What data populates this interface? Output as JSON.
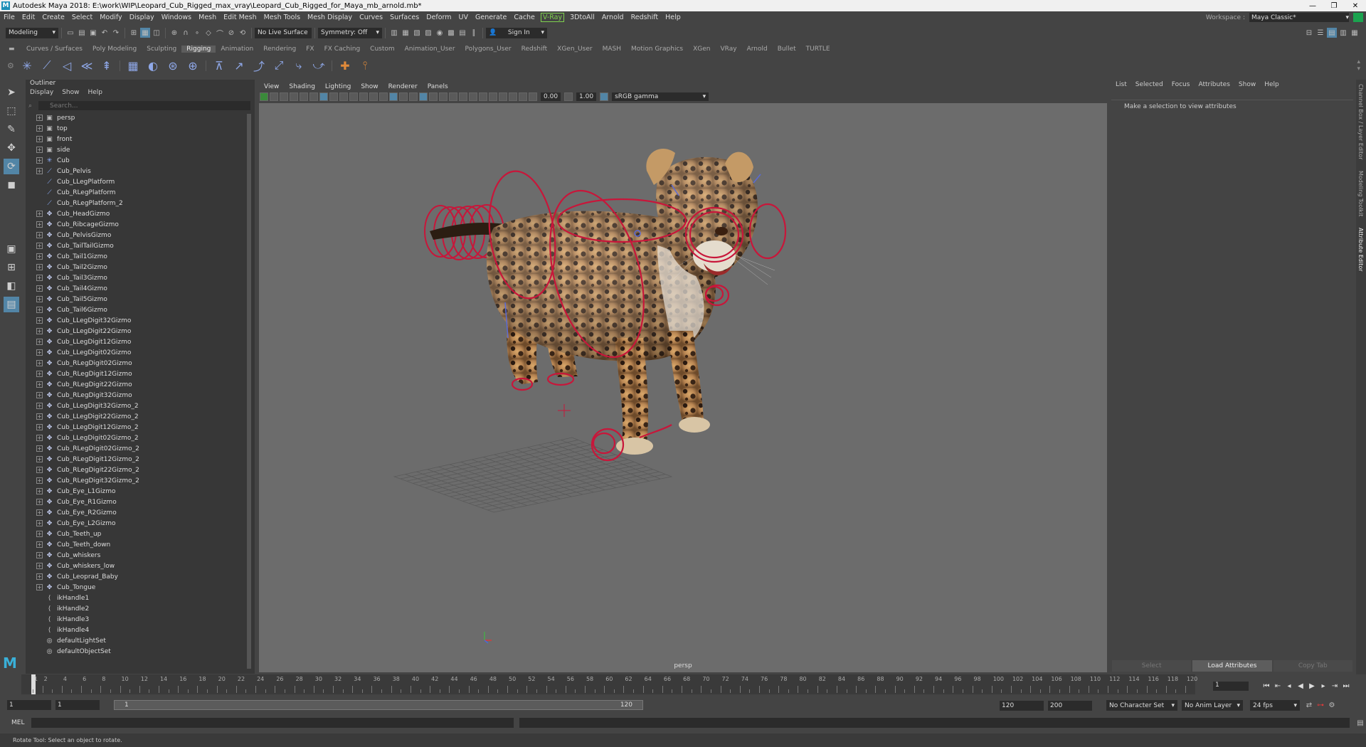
{
  "window": {
    "title": "Autodesk Maya 2018: E:\\work\\WIP\\Leopard_Cub_Rigged_max_vray\\Leopard_Cub_Rigged_for_Maya_mb_arnold.mb*",
    "logo": "M"
  },
  "menubar": {
    "items": [
      "File",
      "Edit",
      "Create",
      "Select",
      "Modify",
      "Display",
      "Windows",
      "Mesh",
      "Edit Mesh",
      "Mesh Tools",
      "Mesh Display",
      "Curves",
      "Surfaces",
      "Deform",
      "UV",
      "Generate",
      "Cache",
      "V-Ray",
      "3DtoAll",
      "Arnold",
      "Redshift",
      "Help"
    ],
    "workspace_label": "Workspace :",
    "workspace_value": "Maya Classic*"
  },
  "statusline": {
    "mode": "Modeling",
    "live_surface": "No Live Surface",
    "symmetry": "Symmetry: Off",
    "sign_in": "Sign In"
  },
  "shelf": {
    "tabs": [
      "Curves / Surfaces",
      "Poly Modeling",
      "Sculpting",
      "Rigging",
      "Animation",
      "Rendering",
      "FX",
      "FX Caching",
      "Custom",
      "Animation_User",
      "Polygons_User",
      "Redshift",
      "XGen_User",
      "MASH",
      "Motion Graphics",
      "XGen",
      "VRay",
      "Arnold",
      "Bullet",
      "TURTLE"
    ],
    "active_tab": "Rigging"
  },
  "outliner": {
    "title": "Outliner",
    "menu": [
      "Display",
      "Show",
      "Help"
    ],
    "search_placeholder": "Search...",
    "items": [
      {
        "name": "persp",
        "icon": "camera-icon",
        "expand": true
      },
      {
        "name": "top",
        "icon": "camera-icon",
        "expand": true
      },
      {
        "name": "front",
        "icon": "camera-icon",
        "expand": true
      },
      {
        "name": "side",
        "icon": "camera-icon",
        "expand": true
      },
      {
        "name": "Cub",
        "icon": "locator-icon",
        "expand": true
      },
      {
        "name": "Cub_Pelvis",
        "icon": "joint-icon",
        "expand": true
      },
      {
        "name": "Cub_LLegPlatform",
        "icon": "joint-icon",
        "expand": false
      },
      {
        "name": "Cub_RLegPlatform",
        "icon": "joint-icon",
        "expand": false
      },
      {
        "name": "Cub_RLegPlatform_2",
        "icon": "joint-icon",
        "expand": false
      },
      {
        "name": "Cub_HeadGizmo",
        "icon": "curve-icon",
        "expand": true
      },
      {
        "name": "Cub_RibcageGizmo",
        "icon": "curve-icon",
        "expand": true
      },
      {
        "name": "Cub_PelvisGizmo",
        "icon": "curve-icon",
        "expand": true
      },
      {
        "name": "Cub_TailTailGizmo",
        "icon": "curve-icon",
        "expand": true
      },
      {
        "name": "Cub_Tail1Gizmo",
        "icon": "curve-icon",
        "expand": true
      },
      {
        "name": "Cub_Tail2Gizmo",
        "icon": "curve-icon",
        "expand": true
      },
      {
        "name": "Cub_Tail3Gizmo",
        "icon": "curve-icon",
        "expand": true
      },
      {
        "name": "Cub_Tail4Gizmo",
        "icon": "curve-icon",
        "expand": true
      },
      {
        "name": "Cub_Tail5Gizmo",
        "icon": "curve-icon",
        "expand": true
      },
      {
        "name": "Cub_Tail6Gizmo",
        "icon": "curve-icon",
        "expand": true
      },
      {
        "name": "Cub_LLegDigit32Gizmo",
        "icon": "curve-icon",
        "expand": true
      },
      {
        "name": "Cub_LLegDigit22Gizmo",
        "icon": "curve-icon",
        "expand": true
      },
      {
        "name": "Cub_LLegDigit12Gizmo",
        "icon": "curve-icon",
        "expand": true
      },
      {
        "name": "Cub_LLegDigit02Gizmo",
        "icon": "curve-icon",
        "expand": true
      },
      {
        "name": "Cub_RLegDigit02Gizmo",
        "icon": "curve-icon",
        "expand": true
      },
      {
        "name": "Cub_RLegDigit12Gizmo",
        "icon": "curve-icon",
        "expand": true
      },
      {
        "name": "Cub_RLegDigit22Gizmo",
        "icon": "curve-icon",
        "expand": true
      },
      {
        "name": "Cub_RLegDigit32Gizmo",
        "icon": "curve-icon",
        "expand": true
      },
      {
        "name": "Cub_LLegDigit32Gizmo_2",
        "icon": "curve-icon",
        "expand": true
      },
      {
        "name": "Cub_LLegDigit22Gizmo_2",
        "icon": "curve-icon",
        "expand": true
      },
      {
        "name": "Cub_LLegDigit12Gizmo_2",
        "icon": "curve-icon",
        "expand": true
      },
      {
        "name": "Cub_LLegDigit02Gizmo_2",
        "icon": "curve-icon",
        "expand": true
      },
      {
        "name": "Cub_RLegDigit02Gizmo_2",
        "icon": "curve-icon",
        "expand": true
      },
      {
        "name": "Cub_RLegDigit12Gizmo_2",
        "icon": "curve-icon",
        "expand": true
      },
      {
        "name": "Cub_RLegDigit22Gizmo_2",
        "icon": "curve-icon",
        "expand": true
      },
      {
        "name": "Cub_RLegDigit32Gizmo_2",
        "icon": "curve-icon",
        "expand": true
      },
      {
        "name": "Cub_Eye_L1Gizmo",
        "icon": "curve-icon",
        "expand": true
      },
      {
        "name": "Cub_Eye_R1Gizmo",
        "icon": "curve-icon",
        "expand": true
      },
      {
        "name": "Cub_Eye_R2Gizmo",
        "icon": "curve-icon",
        "expand": true
      },
      {
        "name": "Cub_Eye_L2Gizmo",
        "icon": "curve-icon",
        "expand": true
      },
      {
        "name": "Cub_Teeth_up",
        "icon": "curve-icon",
        "expand": true
      },
      {
        "name": "Cub_Teeth_down",
        "icon": "curve-icon",
        "expand": true
      },
      {
        "name": "Cub_whiskers",
        "icon": "curve-icon",
        "expand": true
      },
      {
        "name": "Cub_whiskers_low",
        "icon": "curve-icon",
        "expand": true
      },
      {
        "name": "Cub_Leoprad_Baby",
        "icon": "curve-icon",
        "expand": true
      },
      {
        "name": "Cub_Tongue",
        "icon": "curve-icon",
        "expand": true
      },
      {
        "name": "ikHandle1",
        "icon": "ik-icon",
        "expand": false
      },
      {
        "name": "ikHandle2",
        "icon": "ik-icon",
        "expand": false
      },
      {
        "name": "ikHandle3",
        "icon": "ik-icon",
        "expand": false
      },
      {
        "name": "ikHandle4",
        "icon": "ik-icon",
        "expand": false
      },
      {
        "name": "defaultLightSet",
        "icon": "set-icon",
        "expand": false
      },
      {
        "name": "defaultObjectSet",
        "icon": "set-icon",
        "expand": false
      }
    ]
  },
  "viewport": {
    "menu": [
      "View",
      "Shading",
      "Lighting",
      "Show",
      "Renderer",
      "Panels"
    ],
    "exposure": "0.00",
    "gamma": "1.00",
    "color_space": "sRGB gamma",
    "camera_label": "persp"
  },
  "attribute_editor": {
    "menu": [
      "List",
      "Selected",
      "Focus",
      "Attributes",
      "Show",
      "Help"
    ],
    "message": "Make a selection to view attributes",
    "buttons": [
      "Select",
      "Load Attributes",
      "Copy Tab"
    ],
    "side_tabs": [
      "Channel Box / Layer Editor",
      "Modeling Toolkit",
      "Attribute Editor"
    ]
  },
  "timeline": {
    "tick_labels": [
      "1",
      "2",
      "4",
      "6",
      "8",
      "10",
      "12",
      "14",
      "16",
      "18",
      "20",
      "22",
      "24",
      "26",
      "28",
      "30",
      "32",
      "34",
      "36",
      "38",
      "40",
      "42",
      "44",
      "46",
      "48",
      "50",
      "52",
      "54",
      "56",
      "58",
      "60",
      "62",
      "64",
      "66",
      "68",
      "70",
      "72",
      "74",
      "76",
      "78",
      "80",
      "82",
      "84",
      "86",
      "88",
      "90",
      "92",
      "94",
      "96",
      "98",
      "100",
      "102",
      "104",
      "106",
      "108",
      "110",
      "112",
      "114",
      "116",
      "118",
      "120"
    ],
    "current_frame": "1",
    "range_start": "1",
    "range_start2": "1",
    "slider_start": "1",
    "slider_end": "120",
    "anim_end": "120",
    "anim_end2": "200",
    "character_set": "No Character Set",
    "anim_layer": "No Anim Layer",
    "fps": "24 fps"
  },
  "commandline": {
    "label": "MEL"
  },
  "helpline": {
    "text": "Rotate Tool: Select an object to rotate."
  },
  "colors": {
    "rig_control": "#c8163a",
    "viewport_bg": "#6c6c6c",
    "active_tool": "#5285a6",
    "vray_green": "#7fd14f"
  }
}
